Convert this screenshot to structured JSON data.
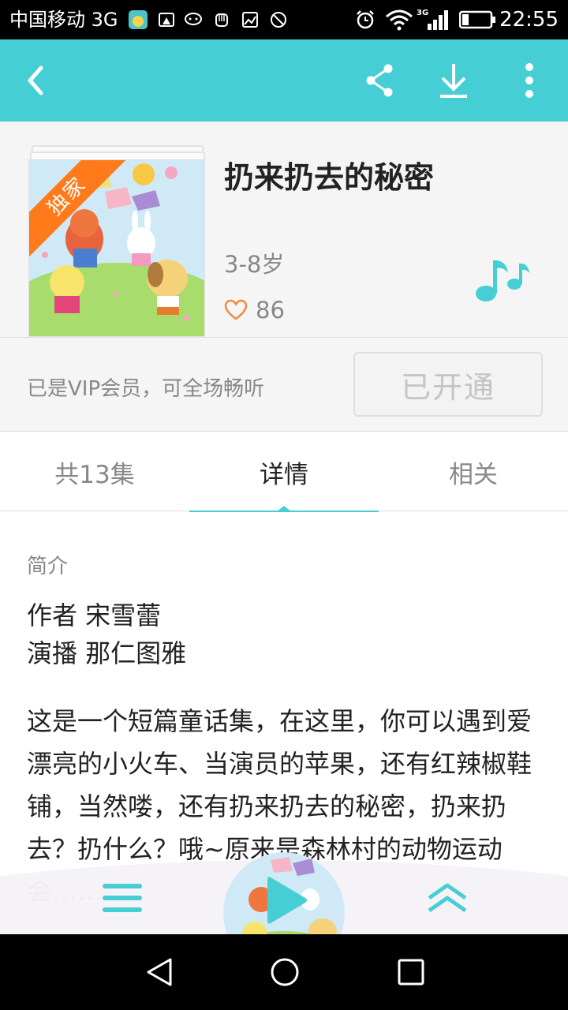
{
  "status_bar": {
    "carrier": "中国移动 3G",
    "network": "3G",
    "time": "22:55"
  },
  "app_bar": {
    "back_icon": "back-arrow-icon",
    "share_icon": "share-icon",
    "download_icon": "download-icon",
    "more_icon": "more-vertical-icon"
  },
  "album": {
    "badge": "独家",
    "title": "扔来扔去的秘密",
    "age_range": "3-8岁",
    "likes": "86",
    "music_icon": "music-note-icon"
  },
  "vip": {
    "status_text": "已是VIP会员，可全场畅听",
    "button_label": "已开通"
  },
  "tabs": [
    {
      "label": "共13集",
      "active": false
    },
    {
      "label": "详情",
      "active": true
    },
    {
      "label": "相关",
      "active": false
    }
  ],
  "details": {
    "section_label": "简介",
    "author_line": "作者 宋雪蕾",
    "narrator_line": "演播 那仁图雅",
    "description": "这是一个短篇童话集，在这里，你可以遇到爱漂亮的小火车、当演员的苹果，还有红辣椒鞋铺，当然喽，还有扔来扔去的秘密，扔来扔去？扔什么？哦~原来是森林村的动物运动会……"
  },
  "player": {
    "playlist_icon": "playlist-icon",
    "play_icon": "play-icon",
    "expand_icon": "expand-up-icon"
  },
  "nav": {
    "back_icon": "nav-back-icon",
    "home_icon": "nav-home-icon",
    "recent_icon": "nav-recent-icon"
  },
  "colors": {
    "accent": "#45cfd4",
    "badge": "#ff7a1a",
    "heart": "#f08a3c"
  }
}
